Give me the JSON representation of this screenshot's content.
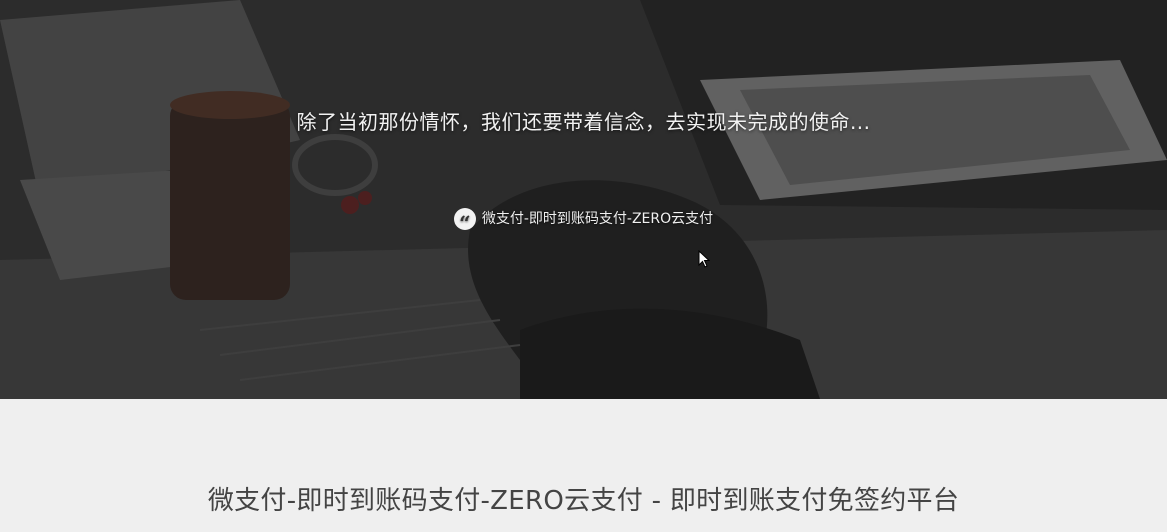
{
  "hero": {
    "quote": "除了当初那份情怀，我们还要带着信念，去实现未完成的使命...",
    "source_icon": "quote-icon",
    "source": "微支付-即时到账码支付-ZERO云支付"
  },
  "footer": {
    "tagline": "微支付-即时到账码支付-ZERO云支付 - 即时到账支付免签约平台"
  },
  "colors": {
    "hero_overlay": "#2b2b2b",
    "footer_bg": "#efefef",
    "text_light": "#f2f2f2",
    "text_dark": "#444444"
  }
}
